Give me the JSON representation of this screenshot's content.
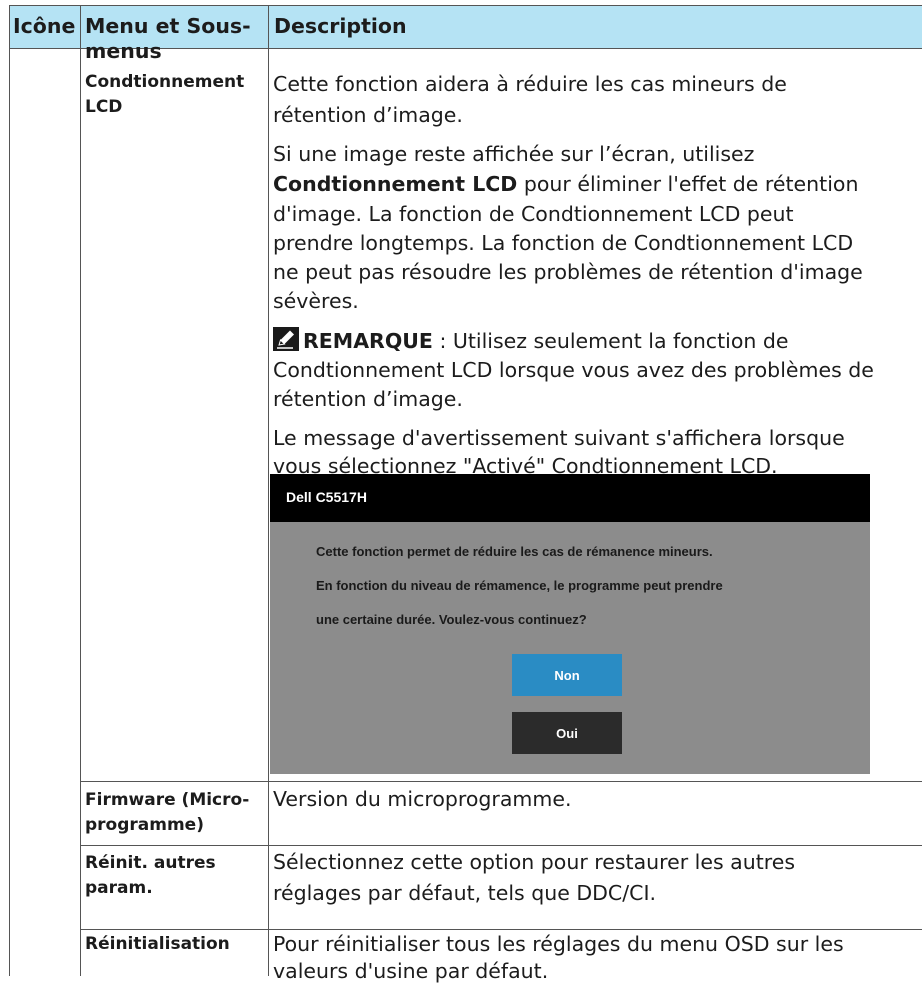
{
  "table": {
    "headers": {
      "icon": "Icône",
      "menu_line1": "Menu et Sous-",
      "menu_line2": "menus",
      "description": "Description"
    },
    "rows": [
      {
        "menu_line1": "Condtionnement",
        "menu_line2": "LCD",
        "description_paragraphs": [
          [
            "Cette fonction aidera à réduire les cas mineurs de",
            "rétention d’image."
          ],
          [
            "Si une image reste affichée sur l’écran, utilisez"
          ],
          [
            "Condtionnement LCD",
            " pour éliminer l'effet de rétention"
          ],
          [
            "d'image. La fonction de Condtionnement LCD peut",
            "prendre longtemps. La fonction de Condtionnement LCD",
            "ne peut pas résoudre les problèmes de rétention d'image",
            "sévères."
          ]
        ],
        "note": {
          "icon": "pencil-note-icon",
          "label": "REMARQUE",
          "text_line1": " : Utilisez seulement la fonction de",
          "text_line2": "Condtionnement LCD lorsque vous avez des problèmes de",
          "text_line3": "rétention d’image."
        },
        "warning_intro": [
          "Le message d'avertissement suivant s'affichera lorsque",
          "vous sélectionnez \"Activé\" Condtionnement LCD."
        ],
        "osd": {
          "title": "Dell C5517H",
          "lines": [
            "Cette fonction permet de réduire les cas de rémanence mineurs.",
            "En fonction du niveau de rémamence, le programme peut prendre",
            "une certaine durée. Voulez-vous continuez?"
          ],
          "button_no": "Non",
          "button_yes": "Oui"
        }
      },
      {
        "menu_line1": "Firmware (Micro-",
        "menu_line2": "programme)",
        "description": "Version du microprogramme."
      },
      {
        "menu_line1": "Réinit. autres",
        "menu_line2": "param.",
        "description_line1": "Sélectionnez cette option pour restaurer les autres",
        "description_line2": "réglages par défaut, tels que DDC/CI."
      },
      {
        "menu_line1": "Réinitialisation",
        "description_line1": "Pour réinitialiser tous les réglages du menu OSD sur les",
        "description_line2": "valeurs d'usine par défaut."
      }
    ]
  },
  "colors": {
    "header_bg": "#b5e3f4",
    "osd_title_bg": "#000000",
    "osd_body_bg": "#8c8c8c",
    "osd_no_button": "#2a8cc4",
    "osd_yes_button": "#2b2b2b"
  }
}
